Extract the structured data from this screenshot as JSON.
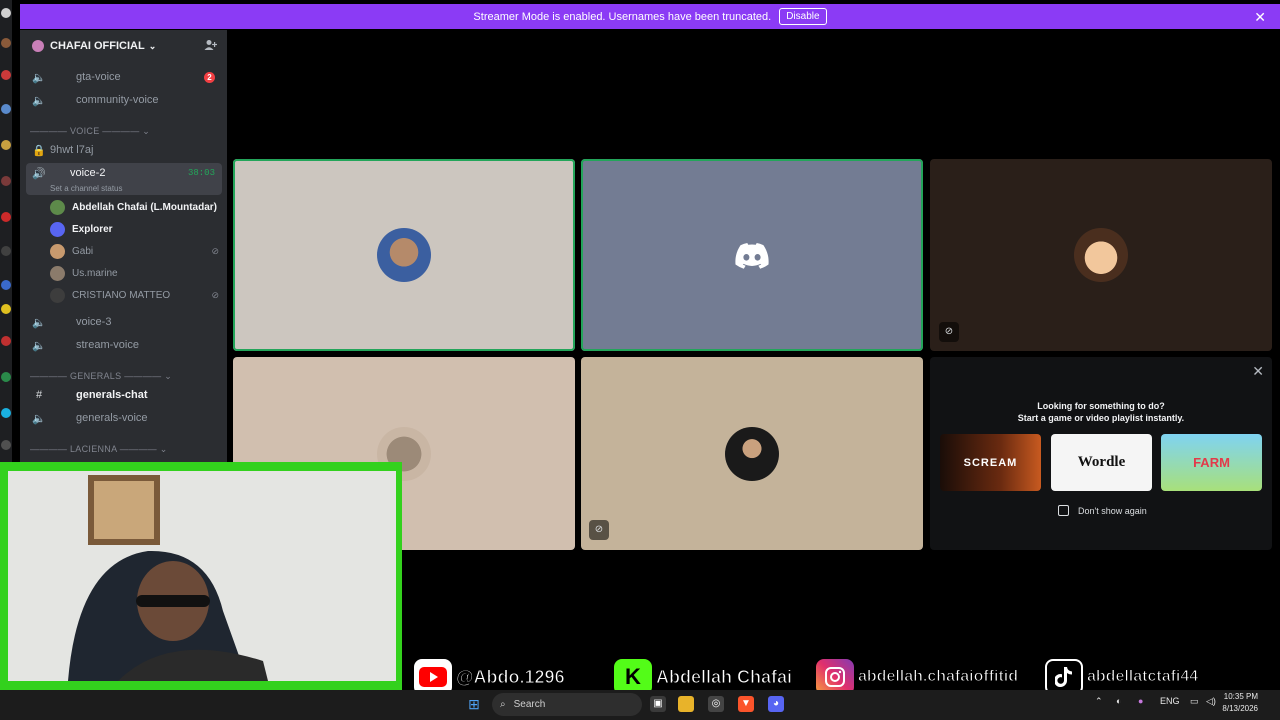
{
  "banner": {
    "text": "Streamer Mode is enabled. Usernames have been truncated.",
    "button": "Disable",
    "close": "✕"
  },
  "server": {
    "name": "CHAFAI OFFICIAL",
    "chevron": "⌄",
    "invite_icon": "person-plus-icon"
  },
  "channels": {
    "gta_voice": {
      "label": "gta-voice",
      "badge": "2"
    },
    "community_voice": {
      "label": "community-voice"
    },
    "voice_category": "———— VOICE ———— ⌄",
    "locked": {
      "label": "9hwt l7aj"
    },
    "voice2": {
      "label": "voice-2",
      "timer": "38:03",
      "status": "Set a channel status"
    },
    "voice3": {
      "label": "voice-3"
    },
    "stream_voice": {
      "label": "stream-voice"
    },
    "generals_category": "———— GENERALS ———— ⌄",
    "generals_chat": {
      "label": "generals-chat"
    },
    "generals_voice": {
      "label": "generals-voice"
    },
    "lacienna_category": "———— LACIENNA ———— ⌄"
  },
  "members": [
    {
      "name": "Abdellah Chafai (L.Mountadar)",
      "color": "#5d8a4a"
    },
    {
      "name": "Explorer",
      "color": "#5865f2"
    },
    {
      "name": "Gabi",
      "color": "#c89a6e"
    },
    {
      "name": "Us.marine",
      "color": "#8b7b6b"
    },
    {
      "name": "CRISTIANO MATTEO",
      "color": "#3d3d3d"
    }
  ],
  "activity": {
    "line1": "Looking for something to do?",
    "line2": "Start a game or video playlist instantly.",
    "games": [
      "SCREAM",
      "Wordle",
      "FARM"
    ],
    "dont_show": "Don't show again"
  },
  "social": {
    "youtube": "@Abdo.1296",
    "kick": "Abdellah Chafai",
    "instagram": "abdellah.chafaioffitid",
    "tiktok": "abdellatctafi44"
  },
  "taskbar": {
    "search": "Search",
    "lang": "ENG",
    "time": "10:35 PM",
    "date": "8/13/2026"
  },
  "colors": {
    "speaking": "#23a55a",
    "banner": "#8b3bf5",
    "webcam_frame": "#33d11d"
  }
}
